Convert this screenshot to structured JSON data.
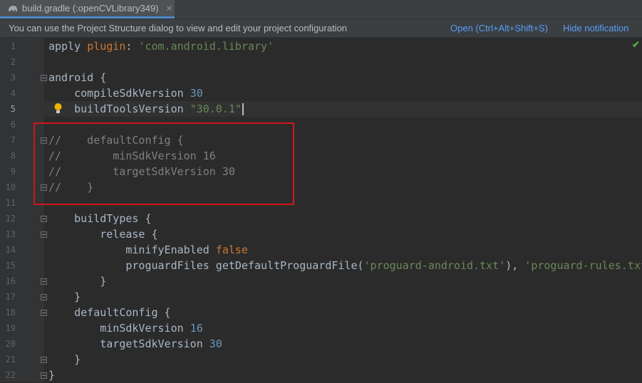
{
  "tab": {
    "title": "build.gradle (:openCVLibrary349)",
    "icon": "gradle-elephant-icon",
    "close": "✕"
  },
  "notification": {
    "message": "You can use the Project Structure dialog to view and edit your project configuration",
    "open_link": "Open (Ctrl+Alt+Shift+S)",
    "hide_link": "Hide notification"
  },
  "inspection_status": "✔",
  "colors": {
    "editor_bg": "#2b2b2b",
    "gutter_bg": "#313335",
    "keyword": "#cc7832",
    "number": "#6897bb",
    "string": "#6a8759",
    "comment": "#808080",
    "link": "#589df6",
    "highlight_box": "#d1161b"
  },
  "current_line": 5,
  "lines": [
    {
      "n": "1",
      "tokens": [
        {
          "t": "apply ",
          "c": "meth"
        },
        {
          "t": "plugin",
          "c": "kw"
        },
        {
          "t": ": ",
          "c": "meth"
        },
        {
          "t": "'com.android.library'",
          "c": "str"
        }
      ]
    },
    {
      "n": "2",
      "tokens": []
    },
    {
      "n": "3",
      "tokens": [
        {
          "t": "android {",
          "c": "meth"
        }
      ]
    },
    {
      "n": "4",
      "tokens": [
        {
          "t": "    compileSdkVersion ",
          "c": "meth"
        },
        {
          "t": "30",
          "c": "num"
        }
      ]
    },
    {
      "n": "5",
      "tokens": [
        {
          "t": "    buildToolsVersion ",
          "c": "meth"
        },
        {
          "t": "\"30.0.1\"",
          "c": "str"
        }
      ]
    },
    {
      "n": "6",
      "tokens": []
    },
    {
      "n": "7",
      "tokens": [
        {
          "t": "//    defaultConfig {",
          "c": "com"
        }
      ]
    },
    {
      "n": "8",
      "tokens": [
        {
          "t": "//        minSdkVersion 16",
          "c": "com"
        }
      ]
    },
    {
      "n": "9",
      "tokens": [
        {
          "t": "//        targetSdkVersion 30",
          "c": "com"
        }
      ]
    },
    {
      "n": "10",
      "tokens": [
        {
          "t": "//    }",
          "c": "com"
        }
      ]
    },
    {
      "n": "11",
      "tokens": []
    },
    {
      "n": "12",
      "tokens": [
        {
          "t": "    buildTypes {",
          "c": "meth"
        }
      ]
    },
    {
      "n": "13",
      "tokens": [
        {
          "t": "        release {",
          "c": "meth"
        }
      ]
    },
    {
      "n": "14",
      "tokens": [
        {
          "t": "            minifyEnabled ",
          "c": "meth"
        },
        {
          "t": "false",
          "c": "kw"
        }
      ]
    },
    {
      "n": "15",
      "tokens": [
        {
          "t": "            proguardFiles getDefaultProguardFile(",
          "c": "meth"
        },
        {
          "t": "'proguard-android.txt'",
          "c": "str"
        },
        {
          "t": "), ",
          "c": "meth"
        },
        {
          "t": "'proguard-rules.txt'",
          "c": "str"
        }
      ]
    },
    {
      "n": "16",
      "tokens": [
        {
          "t": "        }",
          "c": "meth"
        }
      ]
    },
    {
      "n": "17",
      "tokens": [
        {
          "t": "    }",
          "c": "meth"
        }
      ]
    },
    {
      "n": "18",
      "tokens": [
        {
          "t": "    defaultConfig {",
          "c": "meth"
        }
      ]
    },
    {
      "n": "19",
      "tokens": [
        {
          "t": "        minSdkVersion ",
          "c": "meth"
        },
        {
          "t": "16",
          "c": "num"
        }
      ]
    },
    {
      "n": "20",
      "tokens": [
        {
          "t": "        targetSdkVersion ",
          "c": "meth"
        },
        {
          "t": "30",
          "c": "num"
        }
      ]
    },
    {
      "n": "21",
      "tokens": [
        {
          "t": "    }",
          "c": "meth"
        }
      ]
    },
    {
      "n": "22",
      "tokens": [
        {
          "t": "}",
          "c": "meth"
        }
      ]
    }
  ]
}
